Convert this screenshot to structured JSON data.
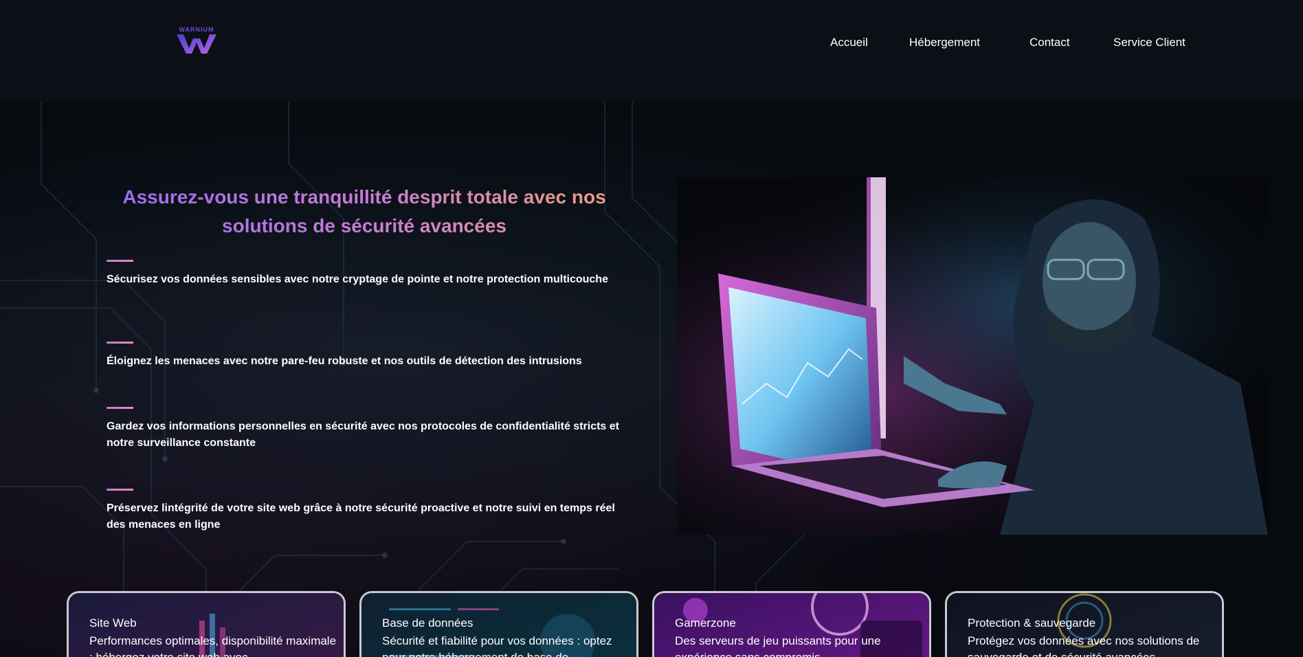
{
  "header": {
    "logo_text": "WARNIUM",
    "nav": [
      "Accueil",
      "Hébergement",
      "Contact",
      "Service Client"
    ]
  },
  "hero": {
    "headline_line1": "Assurez-vous une tranquillité desprit totale avec nos",
    "headline_line2": "solutions de sécurité avancées",
    "features": [
      "Sécurisez vos données sensibles avec notre cryptage de pointe et notre protection multicouche",
      "Éloignez les menaces avec notre pare-feu robuste et nos outils de détection des intrusions",
      "Gardez vos informations personnelles en sécurité avec nos protocoles de confidentialité stricts et notre surveillance constante",
      "Préservez lintégrité de votre site web grâce à notre sécurité proactive et notre suivi en temps réel des menaces en ligne"
    ]
  },
  "cards": [
    {
      "title": "Site Web",
      "desc": "Performances optimales, disponibilité maximale : hébergez votre site web avec"
    },
    {
      "title": "Base de données",
      "desc": "Sécurité et fiabilité pour vos données : optez pour notre hébergement de base de"
    },
    {
      "title": "Gamerzone",
      "desc": "Des serveurs de jeu puissants pour une expérience sans compromis"
    },
    {
      "title": "Protection & sauvegarde",
      "desc": "Protégez vos données avec nos solutions de sauvegarde et de sécurité avancées"
    }
  ],
  "colors": {
    "accent_purple": "#9a6ef0",
    "accent_peach": "#f0a07a",
    "background": "#0a0d12"
  }
}
